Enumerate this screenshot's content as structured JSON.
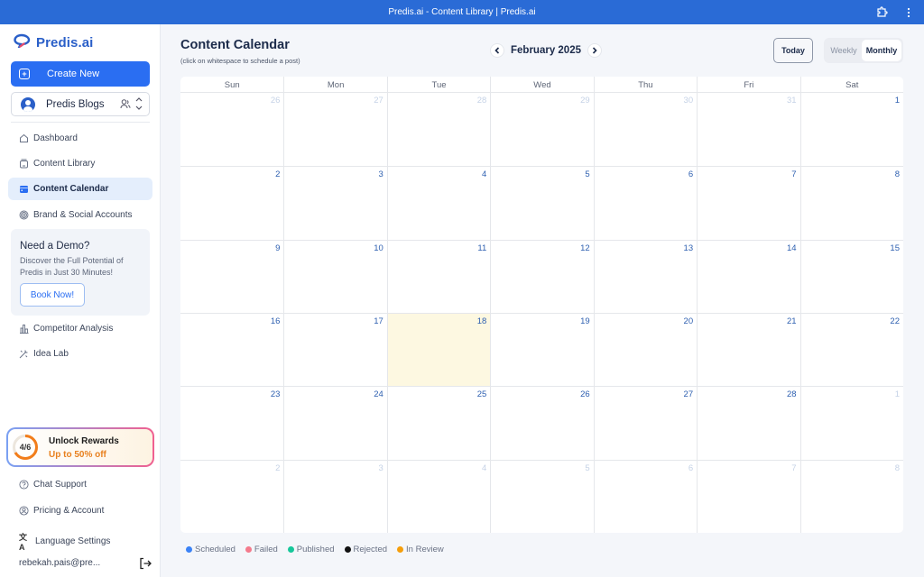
{
  "window": {
    "title": "Predis.ai - Content Library | Predis.ai",
    "icons": [
      "extension-icon",
      "more-vert-icon"
    ]
  },
  "sidebar": {
    "logo_text": "Predis.ai",
    "create_label": "Create New",
    "workspace": {
      "name": "Predis Blogs"
    },
    "nav": [
      {
        "label": "Dashboard",
        "icon": "home-icon",
        "active": false
      },
      {
        "label": "Content Library",
        "icon": "library-icon",
        "active": false
      },
      {
        "label": "Content Calendar",
        "icon": "calendar-icon",
        "active": true
      },
      {
        "label": "Brand & Social Accounts",
        "icon": "fingerprint-icon",
        "active": false
      }
    ],
    "demo": {
      "title": "Need a Demo?",
      "desc": "Discover the Full Potential of Predis in Just 30 Minutes!",
      "button": "Book Now!"
    },
    "nav2": [
      {
        "label": "Competitor Analysis",
        "icon": "chart-icon"
      },
      {
        "label": "Idea Lab",
        "icon": "magic-wand-icon"
      }
    ],
    "rewards": {
      "progress_label": "4/6",
      "progress": 0.667,
      "title": "Unlock Rewards",
      "subtitle": "Up to 50% off"
    },
    "footer": [
      {
        "label": "Chat Support",
        "icon": "help-circle-icon"
      },
      {
        "label": "Pricing & Account",
        "icon": "user-circle-icon"
      },
      {
        "label": "Language Settings",
        "icon": "translate-icon"
      }
    ],
    "user_email": "rebekah.pais@pre..."
  },
  "main": {
    "title": "Content Calendar",
    "subtitle": "(click on whitespace to schedule a post)",
    "month_label": "February 2025",
    "today_label": "Today",
    "views": {
      "weekly": "Weekly",
      "monthly": "Monthly",
      "selected": "Monthly"
    },
    "calendar": {
      "days_of_week": [
        "Sun",
        "Mon",
        "Tue",
        "Wed",
        "Thu",
        "Fri",
        "Sat"
      ],
      "today": 18,
      "weeks": [
        [
          {
            "d": "26",
            "o": true
          },
          {
            "d": "27",
            "o": true
          },
          {
            "d": "28",
            "o": true
          },
          {
            "d": "29",
            "o": true
          },
          {
            "d": "30",
            "o": true
          },
          {
            "d": "31",
            "o": true
          },
          {
            "d": "1",
            "o": false
          }
        ],
        [
          {
            "d": "2",
            "o": false
          },
          {
            "d": "3",
            "o": false
          },
          {
            "d": "4",
            "o": false
          },
          {
            "d": "5",
            "o": false
          },
          {
            "d": "6",
            "o": false
          },
          {
            "d": "7",
            "o": false
          },
          {
            "d": "8",
            "o": false
          }
        ],
        [
          {
            "d": "9",
            "o": false
          },
          {
            "d": "10",
            "o": false
          },
          {
            "d": "11",
            "o": false
          },
          {
            "d": "12",
            "o": false
          },
          {
            "d": "13",
            "o": false
          },
          {
            "d": "14",
            "o": false
          },
          {
            "d": "15",
            "o": false
          }
        ],
        [
          {
            "d": "16",
            "o": false
          },
          {
            "d": "17",
            "o": false
          },
          {
            "d": "18",
            "o": false
          },
          {
            "d": "19",
            "o": false
          },
          {
            "d": "20",
            "o": false
          },
          {
            "d": "21",
            "o": false
          },
          {
            "d": "22",
            "o": false
          }
        ],
        [
          {
            "d": "23",
            "o": false
          },
          {
            "d": "24",
            "o": false
          },
          {
            "d": "25",
            "o": false
          },
          {
            "d": "26",
            "o": false
          },
          {
            "d": "27",
            "o": false
          },
          {
            "d": "28",
            "o": false
          },
          {
            "d": "1",
            "o": true
          }
        ],
        [
          {
            "d": "2",
            "o": true
          },
          {
            "d": "3",
            "o": true
          },
          {
            "d": "4",
            "o": true
          },
          {
            "d": "5",
            "o": true
          },
          {
            "d": "6",
            "o": true
          },
          {
            "d": "7",
            "o": true
          },
          {
            "d": "8",
            "o": true
          }
        ]
      ]
    },
    "legend": [
      {
        "label": "Scheduled",
        "color": "#3b82f6"
      },
      {
        "label": "Failed",
        "color": "#f47a8c"
      },
      {
        "label": "Published",
        "color": "#16c79a"
      },
      {
        "label": "Rejected",
        "color": "#111111"
      },
      {
        "label": "In Review",
        "color": "#f59e0b"
      }
    ]
  },
  "colors": {
    "titlebar": "#2a6bd6",
    "primary": "#2a6ef2",
    "today_cell": "#fdf8e1"
  }
}
